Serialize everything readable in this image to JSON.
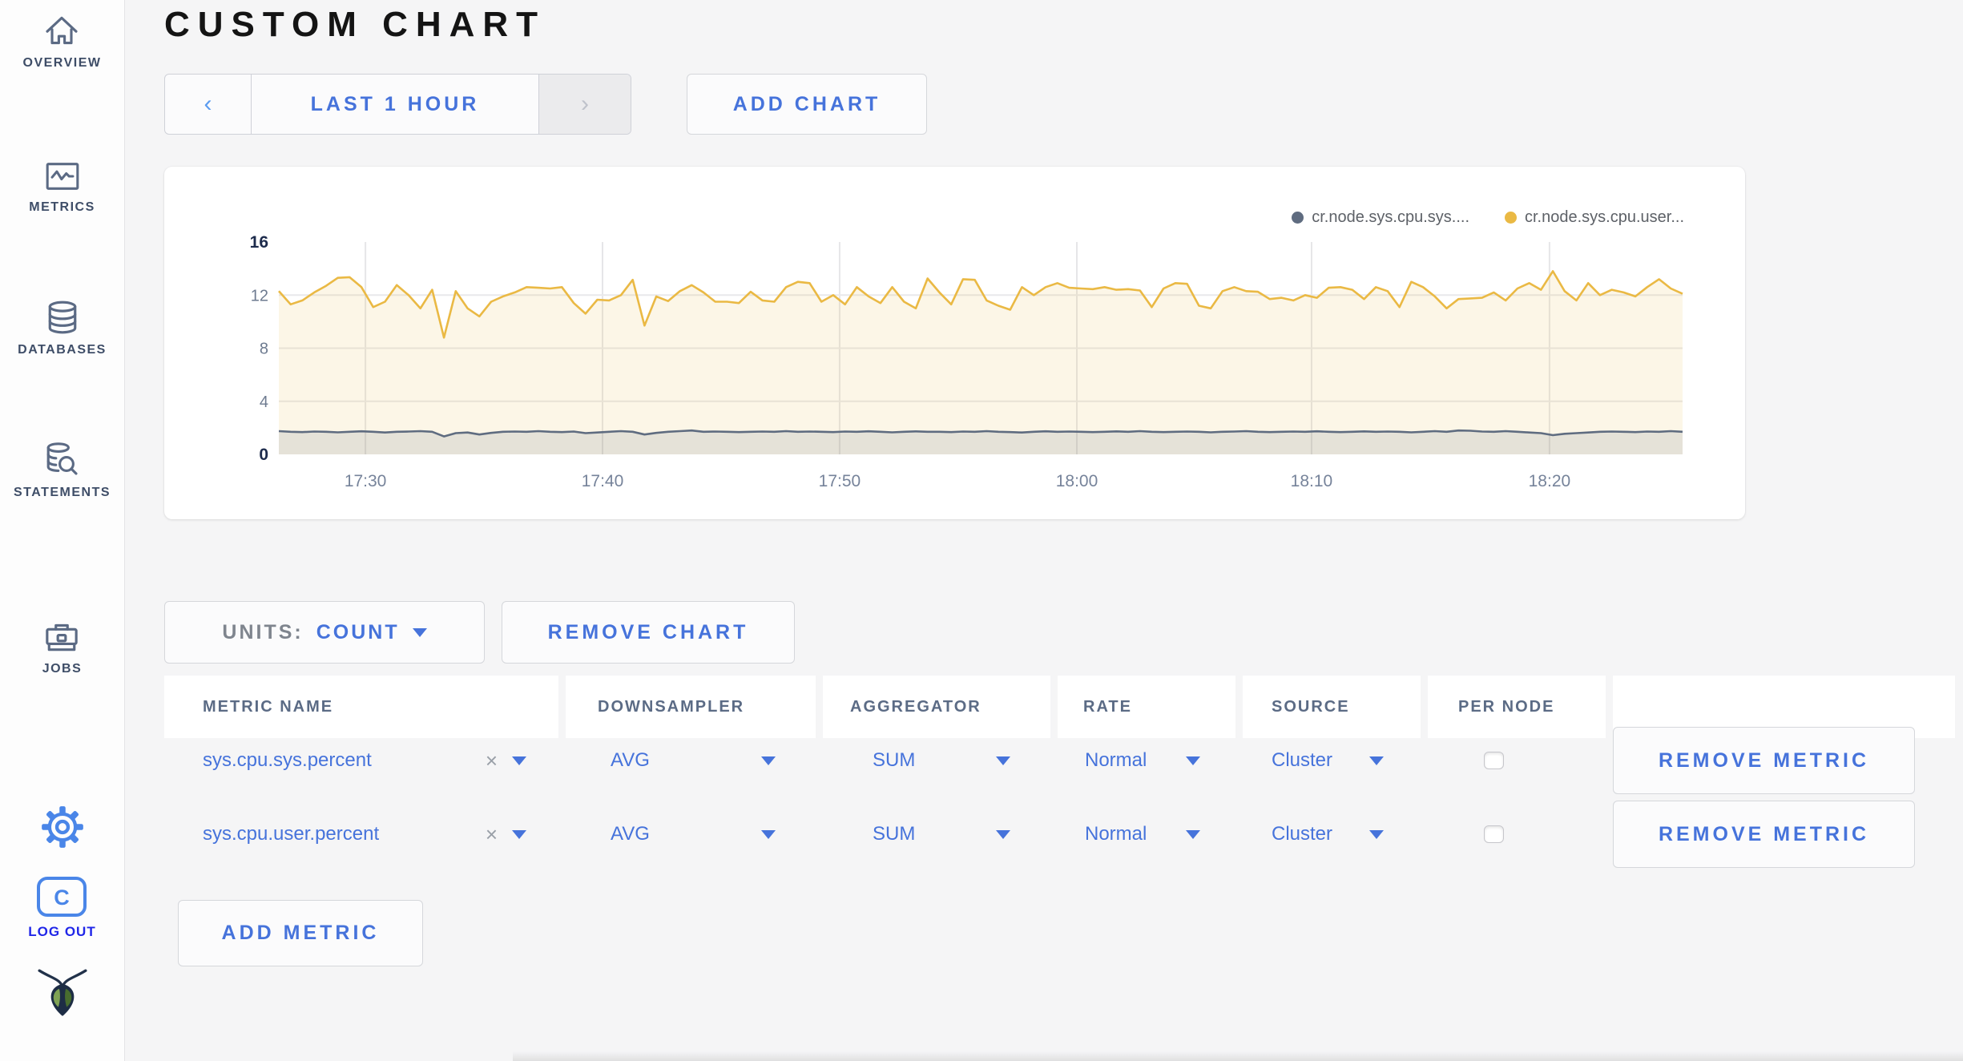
{
  "sidebar": {
    "items": [
      {
        "label": "OVERVIEW",
        "icon": "home-icon"
      },
      {
        "label": "METRICS",
        "icon": "metrics-icon"
      },
      {
        "label": "DATABASES",
        "icon": "databases-icon"
      },
      {
        "label": "STATEMENTS",
        "icon": "statements-icon"
      },
      {
        "label": "JOBS",
        "icon": "jobs-icon"
      }
    ],
    "logout_label": "LOG OUT",
    "logout_icon_letter": "C"
  },
  "header": {
    "title": "CUSTOM CHART"
  },
  "toolbar": {
    "prev_arrow": "‹",
    "time_range_label": "LAST 1 HOUR",
    "next_arrow": "›",
    "add_chart_label": "ADD CHART"
  },
  "chart_controls": {
    "units_label": "UNITS:",
    "units_value": "COUNT",
    "remove_chart_label": "REMOVE CHART",
    "add_metric_label": "ADD METRIC"
  },
  "metric_table": {
    "columns": [
      "METRIC NAME",
      "DOWNSAMPLER",
      "AGGREGATOR",
      "RATE",
      "SOURCE",
      "PER NODE",
      ""
    ],
    "rows": [
      {
        "metric_name": "sys.cpu.sys.percent",
        "clear": "×",
        "downsampler": "AVG",
        "aggregator": "SUM",
        "rate": "Normal",
        "source": "Cluster",
        "per_node_checked": false,
        "remove_label": "REMOVE METRIC"
      },
      {
        "metric_name": "sys.cpu.user.percent",
        "clear": "×",
        "downsampler": "AVG",
        "aggregator": "SUM",
        "rate": "Normal",
        "source": "Cluster",
        "per_node_checked": false,
        "remove_label": "REMOVE METRIC"
      }
    ]
  },
  "chart_data": {
    "type": "line",
    "title": "",
    "xlabel": "",
    "ylabel": "",
    "ylim": [
      0,
      16
    ],
    "y_ticks": [
      0,
      4,
      8,
      12,
      16
    ],
    "y_gridlines": [
      4,
      8,
      12
    ],
    "grid": true,
    "legend_position": "top-right",
    "x_ticks": [
      "17:30",
      "17:40",
      "17:50",
      "18:00",
      "18:10",
      "18:20"
    ],
    "x_tick_fracs": [
      0.0617,
      0.2306,
      0.3995,
      0.5685,
      0.7357,
      0.9052
    ],
    "legend": [
      {
        "name": "cr.node.sys.cpu.sys....",
        "color": "#5f6c80"
      },
      {
        "name": "cr.node.sys.cpu.user...",
        "color": "#eab944"
      }
    ],
    "series": [
      {
        "name": "cr.node.sys.cpu.user...",
        "color": "#eab944",
        "fill": "rgba(234,185,68,0.13)",
        "values": [
          12.3,
          11.3,
          11.6,
          12.2,
          12.7,
          13.3,
          13.35,
          12.6,
          11.1,
          11.5,
          12.75,
          12.0,
          11.0,
          12.4,
          8.8,
          12.3,
          11.0,
          10.4,
          11.5,
          11.9,
          12.2,
          12.6,
          12.55,
          12.5,
          12.6,
          11.4,
          10.6,
          11.65,
          11.6,
          12.0,
          13.15,
          9.7,
          11.9,
          11.55,
          12.3,
          12.75,
          12.2,
          11.5,
          11.5,
          11.4,
          12.25,
          11.6,
          11.5,
          12.6,
          13.0,
          12.9,
          11.5,
          12.0,
          11.3,
          12.6,
          11.9,
          11.4,
          12.6,
          11.5,
          11.0,
          13.25,
          12.2,
          11.3,
          13.2,
          13.15,
          11.6,
          11.2,
          10.9,
          12.6,
          12.0,
          12.6,
          12.9,
          12.55,
          12.5,
          12.45,
          12.6,
          12.4,
          12.45,
          12.35,
          11.1,
          12.5,
          12.9,
          12.85,
          11.2,
          11.0,
          12.3,
          12.6,
          12.3,
          12.25,
          11.7,
          11.8,
          11.6,
          12.0,
          11.8,
          12.55,
          12.6,
          12.4,
          11.7,
          12.6,
          12.3,
          11.1,
          13.0,
          12.6,
          11.9,
          11.0,
          11.7,
          11.75,
          11.8,
          12.2,
          11.6,
          12.5,
          12.9,
          12.4,
          13.8,
          12.3,
          11.6,
          12.9,
          12.0,
          12.4,
          12.2,
          11.9,
          12.6,
          13.2,
          12.5,
          12.1
        ]
      },
      {
        "name": "cr.node.sys.cpu.sys....",
        "color": "#5f6c80",
        "fill": "rgba(95,108,128,0.14)",
        "values": [
          1.75,
          1.7,
          1.68,
          1.72,
          1.7,
          1.66,
          1.7,
          1.74,
          1.7,
          1.65,
          1.7,
          1.72,
          1.75,
          1.7,
          1.35,
          1.6,
          1.65,
          1.5,
          1.62,
          1.7,
          1.72,
          1.7,
          1.75,
          1.7,
          1.68,
          1.72,
          1.6,
          1.65,
          1.7,
          1.75,
          1.7,
          1.5,
          1.62,
          1.7,
          1.75,
          1.8,
          1.7,
          1.72,
          1.7,
          1.68,
          1.7,
          1.72,
          1.7,
          1.75,
          1.7,
          1.72,
          1.7,
          1.68,
          1.72,
          1.7,
          1.74,
          1.7,
          1.66,
          1.7,
          1.73,
          1.7,
          1.7,
          1.68,
          1.72,
          1.7,
          1.75,
          1.7,
          1.68,
          1.65,
          1.7,
          1.74,
          1.7,
          1.72,
          1.7,
          1.68,
          1.7,
          1.73,
          1.7,
          1.75,
          1.7,
          1.68,
          1.7,
          1.72,
          1.7,
          1.66,
          1.7,
          1.72,
          1.75,
          1.7,
          1.68,
          1.7,
          1.72,
          1.7,
          1.74,
          1.7,
          1.68,
          1.7,
          1.73,
          1.7,
          1.72,
          1.7,
          1.66,
          1.7,
          1.75,
          1.7,
          1.8,
          1.78,
          1.72,
          1.7,
          1.75,
          1.7,
          1.65,
          1.6,
          1.45,
          1.55,
          1.6,
          1.65,
          1.7,
          1.72,
          1.7,
          1.68,
          1.72,
          1.7,
          1.75,
          1.7
        ]
      }
    ]
  },
  "colors": {
    "accent_blue": "#4673db",
    "logout_blue": "#2026e8",
    "series_yellow": "#eab944",
    "series_slate": "#5f6c80",
    "page_bg": "#f5f5f6"
  }
}
